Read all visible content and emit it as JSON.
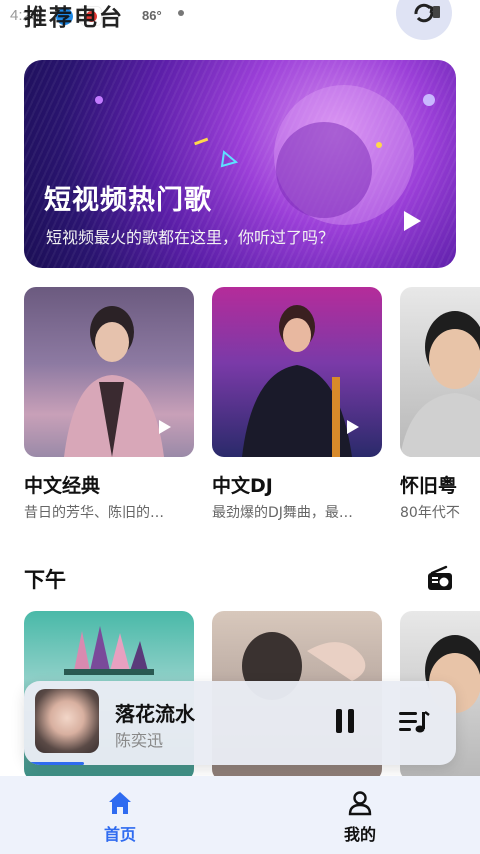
{
  "status_bar": {
    "time": "4:23",
    "temperature": "86°"
  },
  "header": {
    "section_title": "推荐电台"
  },
  "banner": {
    "title": "短视频热门歌",
    "subtitle": "短视频最火的歌都在这里，你听过了吗？"
  },
  "playlists_row1": [
    {
      "title": "中文经典",
      "desc": "昔日的芳华、陈旧的…"
    },
    {
      "title": "中文DJ",
      "desc": "最劲爆的DJ舞曲，最…"
    },
    {
      "title": "怀旧粤",
      "desc": "80年代不"
    }
  ],
  "section2": {
    "title": "下午"
  },
  "now_playing": {
    "song": "落花流水",
    "artist": "陈奕迅",
    "progress": 0.14
  },
  "tabbar": {
    "home_label": "首页",
    "me_label": "我的"
  },
  "colors": {
    "accent": "#2f6bf0",
    "tabbar_bg": "#eef2fb"
  }
}
